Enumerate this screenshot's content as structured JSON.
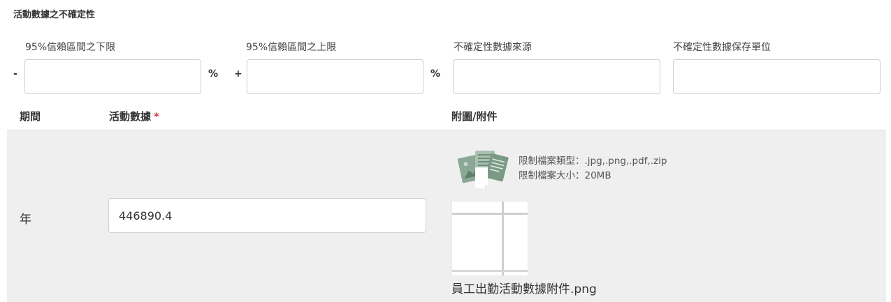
{
  "section": {
    "title": "活動數據之不確定性"
  },
  "uncertainty": {
    "lower": {
      "label": "95%信賴區間之下限",
      "sign": "-",
      "unit": "%",
      "value": ""
    },
    "upper": {
      "label": "95%信賴區間之上限",
      "sign": "+",
      "unit": "%",
      "value": ""
    },
    "source": {
      "label": "不確定性數據來源",
      "value": ""
    },
    "storage": {
      "label": "不確定性數據保存單位",
      "value": ""
    }
  },
  "table": {
    "headers": {
      "period": "期間",
      "activity": "活動數據",
      "required_mark": "*",
      "attachment": "附圖/附件"
    },
    "row": {
      "period": "年",
      "activity_value": "446890.4",
      "upload": {
        "icon": "document-upload-icon",
        "file_types": "限制檔案類型：.jpg,.png,.pdf,.zip",
        "file_size": "限制檔案大小：20MB"
      },
      "attachment_file": "員工出勤活動數據附件.png"
    }
  },
  "colors": {
    "required": "#d9363e",
    "row_background": "#efefef",
    "icon_green": "#7a9a86"
  }
}
